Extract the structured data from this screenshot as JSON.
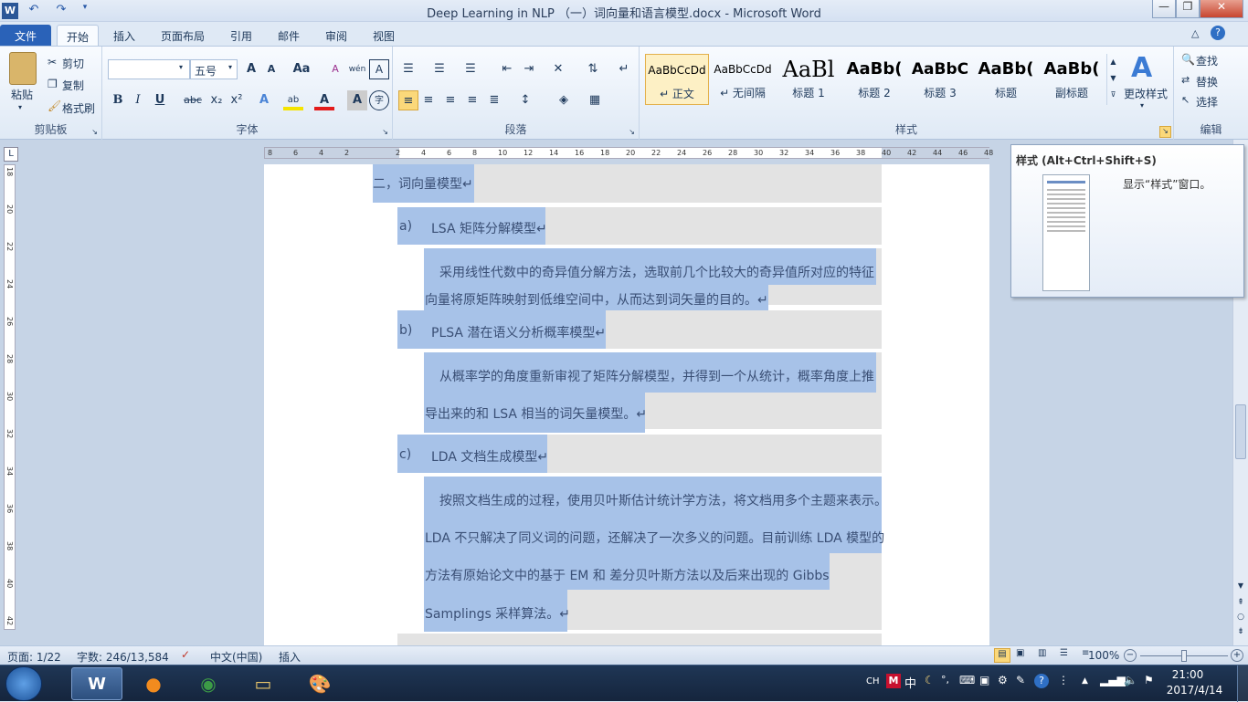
{
  "window": {
    "title": "Deep Learning in NLP （一）词向量和语言模型.docx - Microsoft Word"
  },
  "quick_access": {
    "app_icon": "W",
    "undo": "↶",
    "redo": "↷"
  },
  "tabs": [
    {
      "label": "文件"
    },
    {
      "label": "开始"
    },
    {
      "label": "插入"
    },
    {
      "label": "页面布局"
    },
    {
      "label": "引用"
    },
    {
      "label": "邮件"
    },
    {
      "label": "审阅"
    },
    {
      "label": "视图"
    }
  ],
  "ribbon": {
    "clipboard": {
      "paste": "粘贴",
      "cut": "剪切",
      "copy": "复制",
      "format_painter": "格式刷",
      "group": "剪贴板"
    },
    "font": {
      "font_name": "",
      "font_size": "五号",
      "group": "字体",
      "bold": "B",
      "italic": "I",
      "underline": "U",
      "strike": "abc",
      "sub": "x₂",
      "sup": "x²",
      "grow": "A",
      "shrink": "A",
      "case": "Aa",
      "clear": "A",
      "pinyin": "wén",
      "border": "A",
      "font_color": "A",
      "shade": "A",
      "circle": "字"
    },
    "paragraph": {
      "group": "段落"
    },
    "styles": {
      "group": "样式",
      "items": [
        {
          "sample": "AaBbCcDd",
          "name": "↵ 正文"
        },
        {
          "sample": "AaBbCcDd",
          "name": "↵ 无间隔"
        },
        {
          "sample": "AaBl",
          "name": "标题 1"
        },
        {
          "sample": "AaBb(",
          "name": "标题 2"
        },
        {
          "sample": "AaBbC",
          "name": "标题 3"
        },
        {
          "sample": "AaBb(",
          "name": "标题"
        },
        {
          "sample": "AaBb(",
          "name": "副标题"
        }
      ],
      "change_styles": "更改样式"
    },
    "editing": {
      "group": "编辑",
      "find": "查找",
      "replace": "替换",
      "select": "选择"
    }
  },
  "ruler": {
    "h_ticks": [
      "8",
      "6",
      "4",
      "2",
      "",
      "2",
      "4",
      "6",
      "8",
      "10",
      "12",
      "14",
      "16",
      "18",
      "20",
      "22",
      "24",
      "26",
      "28",
      "30",
      "32",
      "34",
      "36",
      "38",
      "40",
      "42",
      "44",
      "46",
      "48"
    ],
    "v_ticks": [
      "18",
      "20",
      "22",
      "24",
      "26",
      "28",
      "30",
      "32",
      "34",
      "36",
      "38",
      "40",
      "42"
    ]
  },
  "document": {
    "heading": "二，词向量模型↵",
    "a_label": "a)",
    "a_title": "LSA 矩阵分解模型↵",
    "a_p1": "采用线性代数中的奇异值分解方法，选取前几个比较大的奇异值所对应的特征",
    "a_p2": "向量将原矩阵映射到低维空间中，从而达到词矢量的目的。↵",
    "b_label": "b)",
    "b_title": "PLSA 潜在语义分析概率模型↵",
    "b_p1": "从概率学的角度重新审视了矩阵分解模型，并得到一个从统计，概率角度上推",
    "b_p2": "导出来的和 LSA 相当的词矢量模型。↵",
    "c_label": "c)",
    "c_title": "LDA 文档生成模型↵",
    "c_p1": "按照文档生成的过程，使用贝叶斯估计统计学方法，将文档用多个主题来表示。",
    "c_p2": "LDA 不只解决了同义词的问题，还解决了一次多义的问题。目前训练 LDA 模型的",
    "c_p3": "方法有原始论文中的基于 EM 和 差分贝叶斯方法以及后来出现的 Gibbs",
    "c_p4": "Samplings 采样算法。↵"
  },
  "tooltip": {
    "title": "样式 (Alt+Ctrl+Shift+S)",
    "desc": "显示“样式”窗口。"
  },
  "status": {
    "page": "页面: 1/22",
    "words": "字数: 246/13,584",
    "lang": "中文(中国)",
    "mode": "插入",
    "zoom": "100%"
  },
  "taskbar": {
    "time": "21:00",
    "date": "2017/4/14",
    "ime": "CH"
  }
}
